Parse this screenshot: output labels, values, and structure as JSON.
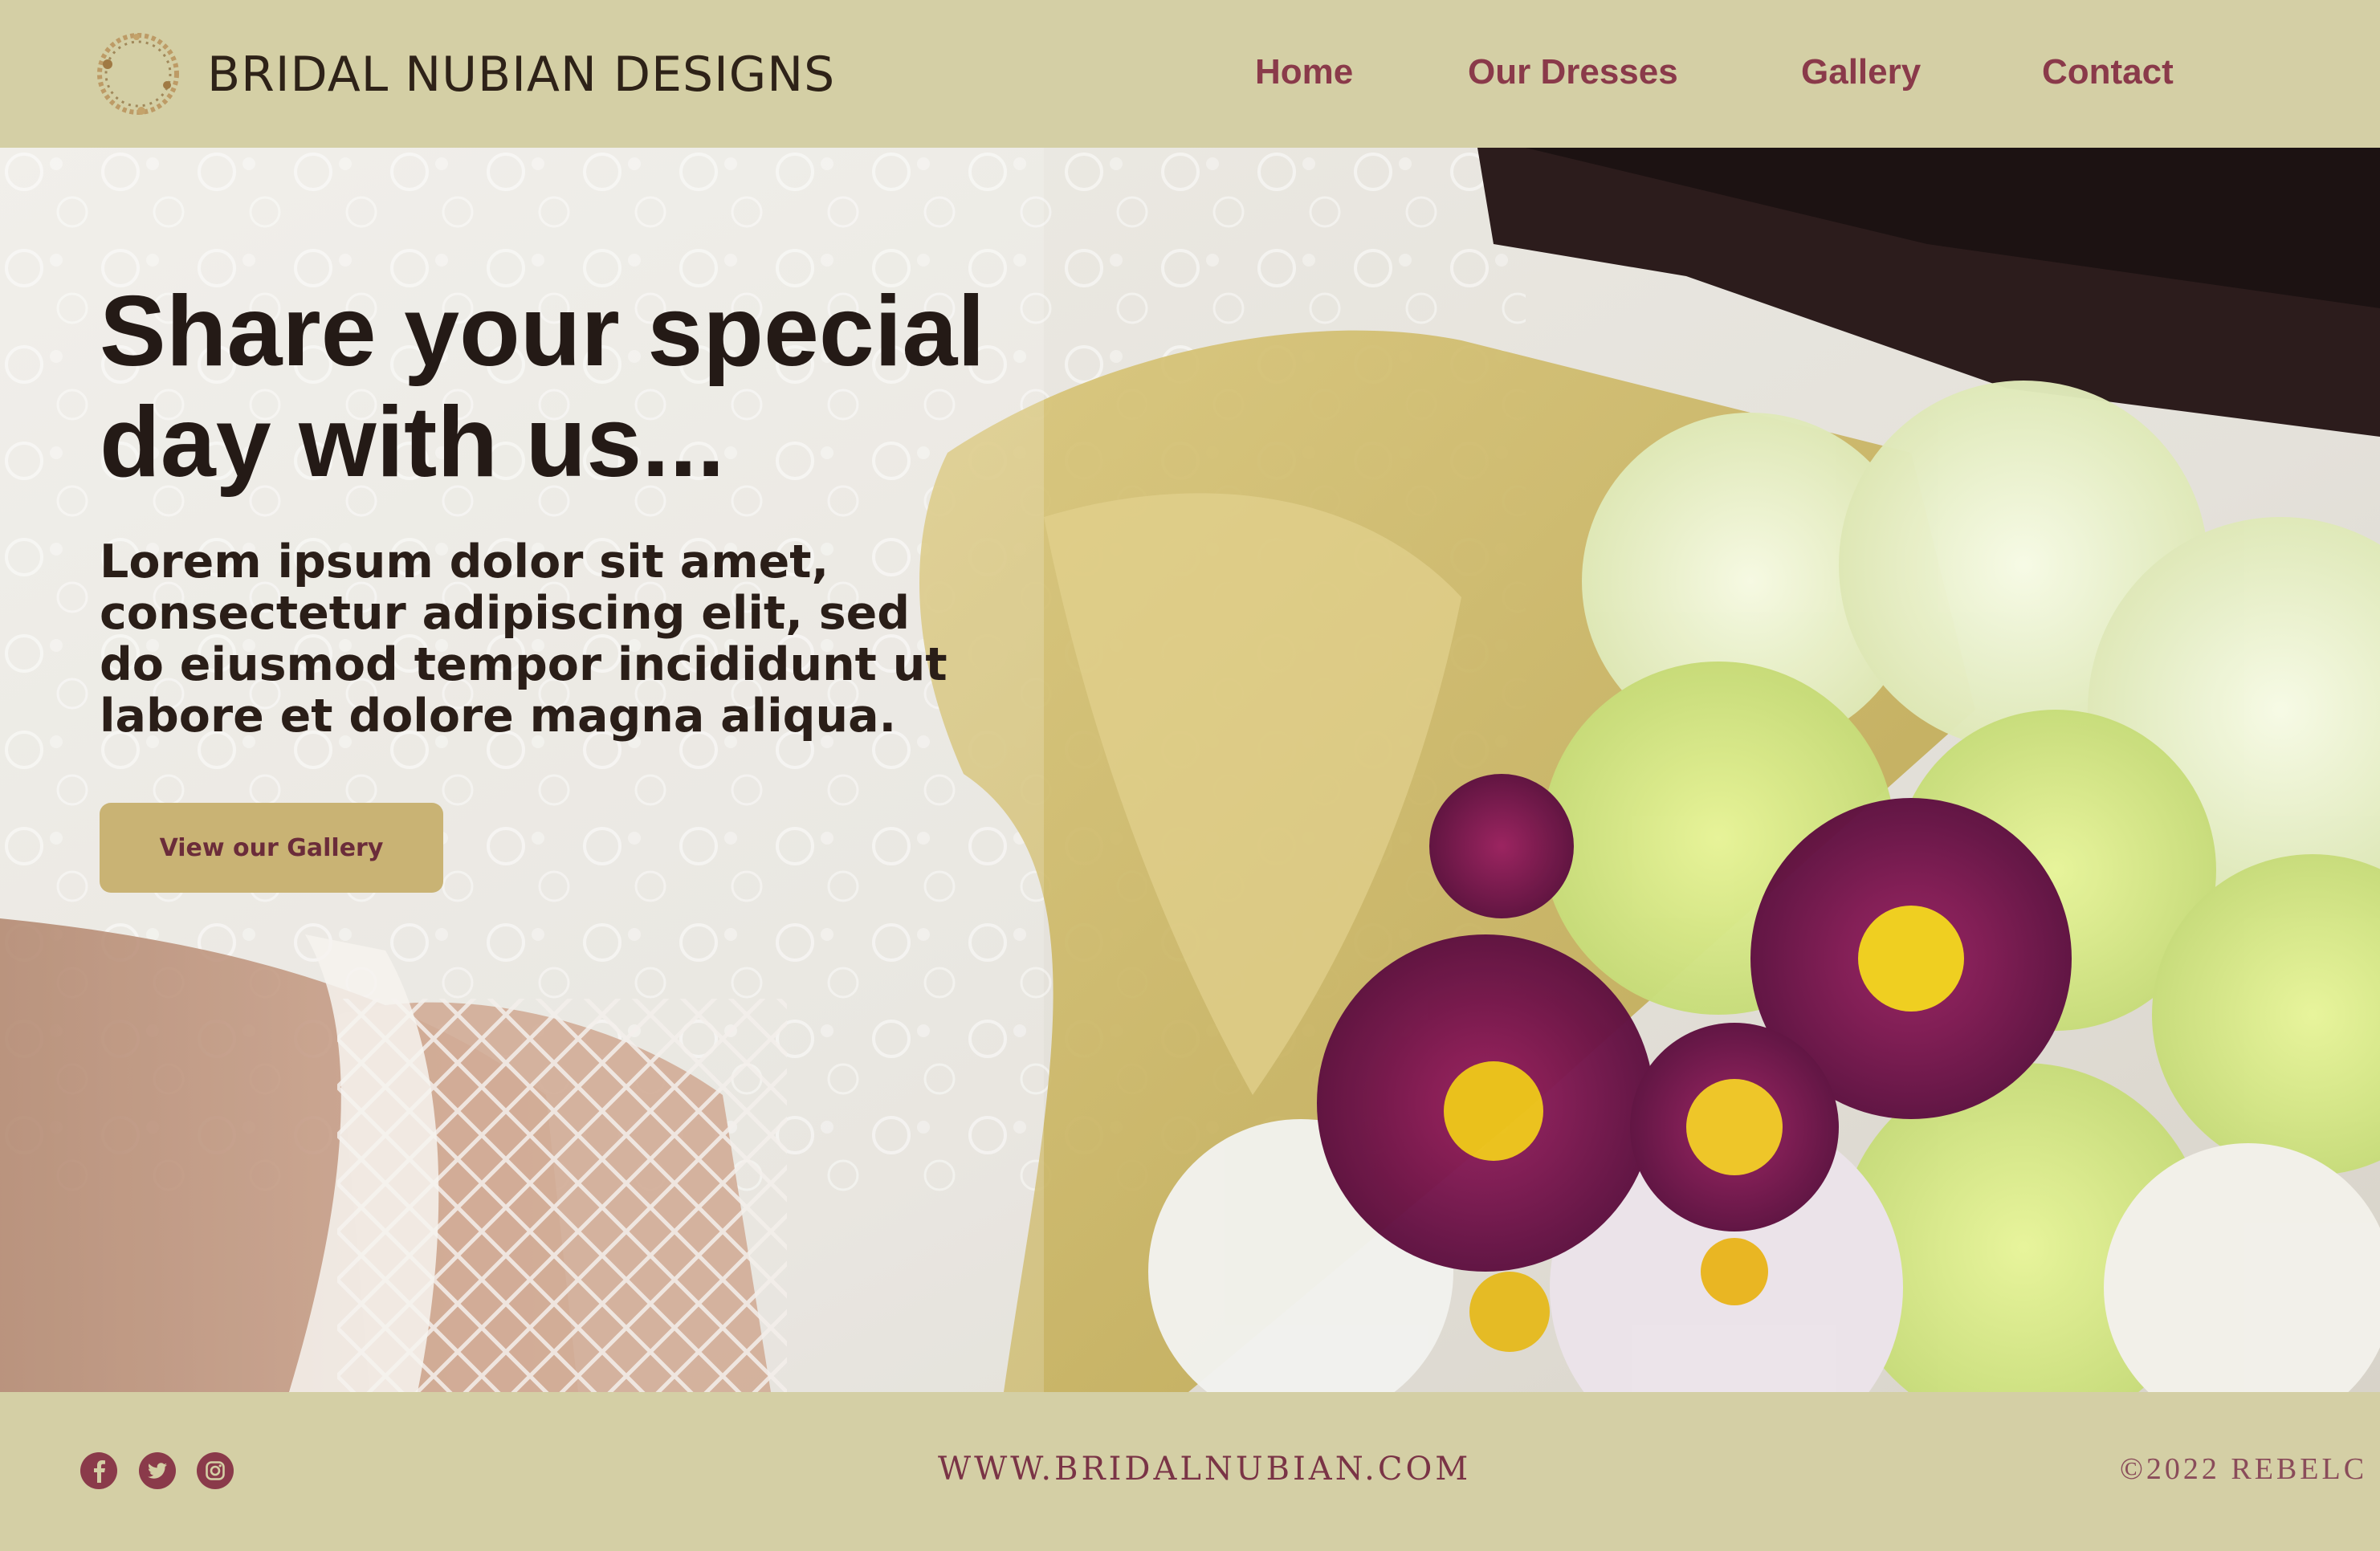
{
  "header": {
    "logo_icon": "floral-wreath-icon",
    "brand": "BRIDAL NUBIAN DESIGNS",
    "nav": [
      {
        "label": "Home"
      },
      {
        "label": "Our Dresses"
      },
      {
        "label": "Gallery"
      },
      {
        "label": "Contact"
      }
    ]
  },
  "hero": {
    "title": "Share your special day with us...",
    "body": "Lorem ipsum dolor sit amet, consectetur adipiscing elit, sed do eiusmod tempor incididunt ut labore et dolore magna aliqua.",
    "cta_label": "View our Gallery"
  },
  "footer": {
    "social": [
      {
        "icon": "facebook-icon"
      },
      {
        "icon": "twitter-icon"
      },
      {
        "icon": "instagram-icon"
      }
    ],
    "url": "WWW.BRIDALNUBIAN.COM",
    "copyright": "©2022 REBELC"
  },
  "colors": {
    "band": "#d4cfa5",
    "accent": "#8a3a4a",
    "button": "#c9b374",
    "heading": "#241a16"
  }
}
